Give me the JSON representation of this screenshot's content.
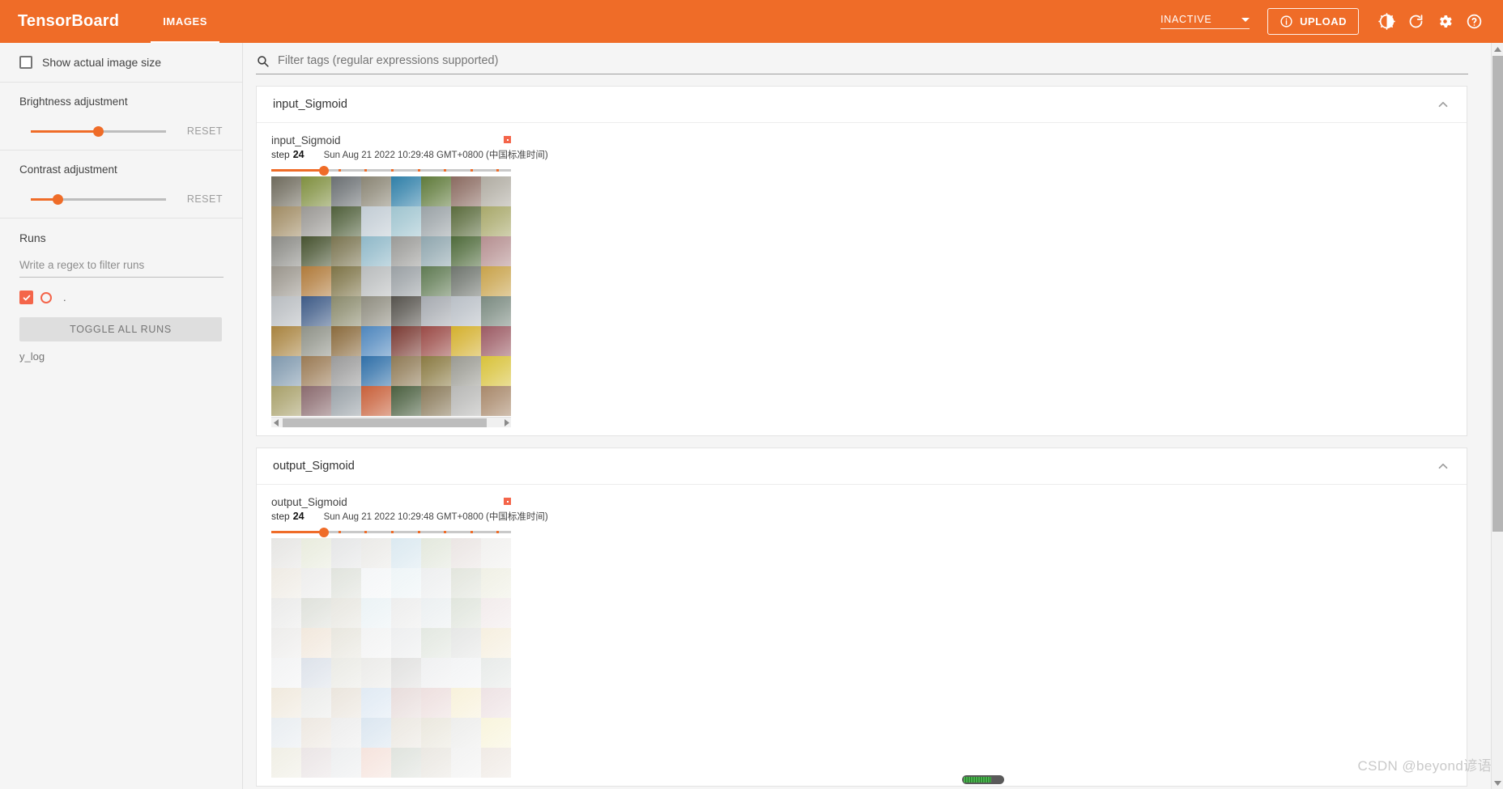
{
  "app": {
    "brand": "TensorBoard",
    "tabs": [
      {
        "label": "IMAGES",
        "active": true
      }
    ],
    "status_select": {
      "value": "INACTIVE"
    },
    "upload_label": "UPLOAD",
    "icons": {
      "info": "info-icon",
      "brightness": "brightness-icon",
      "refresh": "refresh-icon",
      "settings": "gear-icon",
      "help": "help-icon",
      "caret": "chevron-down-icon"
    },
    "accent_color": "#ef6c28",
    "run_color": "#f4654a"
  },
  "sidebar": {
    "show_actual_size": {
      "label": "Show actual image size",
      "checked": false
    },
    "brightness": {
      "label": "Brightness adjustment",
      "reset_label": "RESET",
      "percent": 50
    },
    "contrast": {
      "label": "Contrast adjustment",
      "reset_label": "RESET",
      "percent": 20
    },
    "runs": {
      "title": "Runs",
      "filter_placeholder": "Write a regex to filter runs",
      "filter_value": "",
      "items": [
        {
          "label": ".",
          "selected": true,
          "color": "#f4654a"
        }
      ],
      "toggle_all_label": "TOGGLE ALL RUNS",
      "footer_label": "y_log"
    }
  },
  "main": {
    "tag_filter": {
      "placeholder": "Filter tags (regular expressions supported)",
      "value": "",
      "icon": "search-icon"
    },
    "cards": [
      {
        "header": "input_Sigmoid",
        "collapse_icon": "chevron-up-icon",
        "image": {
          "tag": "input_Sigmoid",
          "step_label": "step",
          "step_value": "24",
          "timestamp": "Sun Aug 21 2022 10:29:48 GMT+0800 (中国标准时间)",
          "slider_percent": 22,
          "pin_icon": "pin-icon",
          "faded": false
        }
      },
      {
        "header": "output_Sigmoid",
        "collapse_icon": "chevron-up-icon",
        "image": {
          "tag": "output_Sigmoid",
          "step_label": "step",
          "step_value": "24",
          "timestamp": "Sun Aug 21 2022 10:29:48 GMT+0800 (中国标准时间)",
          "slider_percent": 22,
          "pin_icon": "pin-icon",
          "faded": true
        }
      }
    ]
  },
  "overlay": {
    "watermark": "CSDN @beyond谚语"
  },
  "image_grid": {
    "columns": 8,
    "rows": 8,
    "note": "CIFAR-10 style 8x8 thumbnail sheet; cell colors approximate the photo tiles",
    "cells": [
      [
        "#6e6a5c",
        "#7f8f3f",
        "#6a6f72",
        "#8a8574",
        "#2f7fa8",
        "#5f7a3a",
        "#8a6a60",
        "#b0aca2"
      ],
      [
        "#a08b63",
        "#9a9894",
        "#4f5f3a",
        "#c2ccd4",
        "#9fc4cf",
        "#9aa2a6",
        "#5a6b3c",
        "#a8a86a"
      ],
      [
        "#8a8a85",
        "#46522f",
        "#7a7450",
        "#8fb8c8",
        "#9a9a97",
        "#8fa6ae",
        "#4e6a3a",
        "#b58f90"
      ],
      [
        "#9a958c",
        "#b07a3a",
        "#7d7346",
        "#b9bcbd",
        "#9aa0a4",
        "#5f7a52",
        "#6f756e",
        "#c8a24a"
      ],
      [
        "#b8bcc0",
        "#3d5a86",
        "#8a8a6c",
        "#8f8d80",
        "#55524c",
        "#a6aab0",
        "#b9bfc6",
        "#7a8a80"
      ],
      [
        "#a8833f",
        "#8f9288",
        "#8a6a3c",
        "#4e86bd",
        "#7a3a33",
        "#9a4a46",
        "#d4b02e",
        "#9b5a63"
      ],
      [
        "#7f98ad",
        "#9a7a54",
        "#9a9a9a",
        "#2f6fa8",
        "#8f7a55",
        "#8a7a42",
        "#9a9a92",
        "#d8c23a"
      ],
      [
        "#a8a06a",
        "#8a6a6e",
        "#9aa2a8",
        "#c8603a",
        "#4a5f3f",
        "#8a7a5a",
        "#b8b8b6",
        "#a8886a"
      ]
    ]
  }
}
